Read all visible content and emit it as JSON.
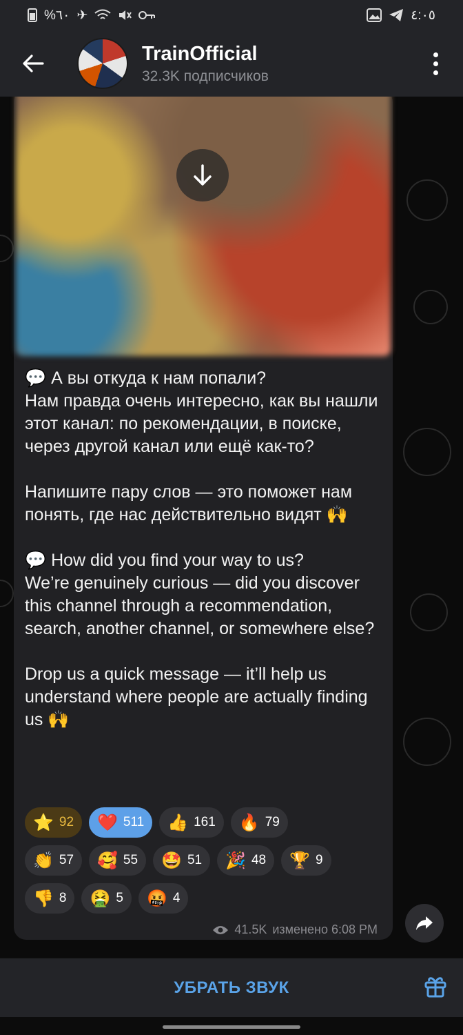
{
  "statusbar": {
    "left_text": "%٦٠",
    "time": "٤:٠٥"
  },
  "header": {
    "title": "TrainOfficial",
    "subtitle": "32.3K подписчиков"
  },
  "message": {
    "text": "💬 А вы откуда к нам попали?\nНам правда очень интересно, как вы нашли этот канал: по рекомендации, в поиске, через другой канал или ещё как-то?\n\nНапишите пару слов — это поможет нам понять, где нас действительно видят 🙌\n\n💬 How did you find your way to us?\nWe’re genuinely curious — did you discover this channel through a recommendation, search, another channel, or somewhere else?\n\nDrop us a quick message — it’ll help us understand where people are actually finding us 🙌",
    "views": "41.5K",
    "edited": "изменено 6:08 PM"
  },
  "reactions": [
    [
      {
        "emoji": "⭐",
        "count": "92",
        "style": "gold"
      },
      {
        "emoji": "❤️",
        "count": "511",
        "style": "active"
      },
      {
        "emoji": "👍",
        "count": "161",
        "style": ""
      },
      {
        "emoji": "🔥",
        "count": "79",
        "style": ""
      }
    ],
    [
      {
        "emoji": "👏",
        "count": "57",
        "style": ""
      },
      {
        "emoji": "🥰",
        "count": "55",
        "style": ""
      },
      {
        "emoji": "🤩",
        "count": "51",
        "style": ""
      },
      {
        "emoji": "🎉",
        "count": "48",
        "style": ""
      },
      {
        "emoji": "🏆",
        "count": "9",
        "style": ""
      }
    ],
    [
      {
        "emoji": "👎",
        "count": "8",
        "style": ""
      },
      {
        "emoji": "🤮",
        "count": "5",
        "style": ""
      },
      {
        "emoji": "🤬",
        "count": "4",
        "style": ""
      }
    ]
  ],
  "bottom": {
    "mute_label": "УБРАТЬ ЗВУК"
  },
  "colors": {
    "accent": "#5aa3e8",
    "bubble": "#212124",
    "header": "#232428"
  }
}
